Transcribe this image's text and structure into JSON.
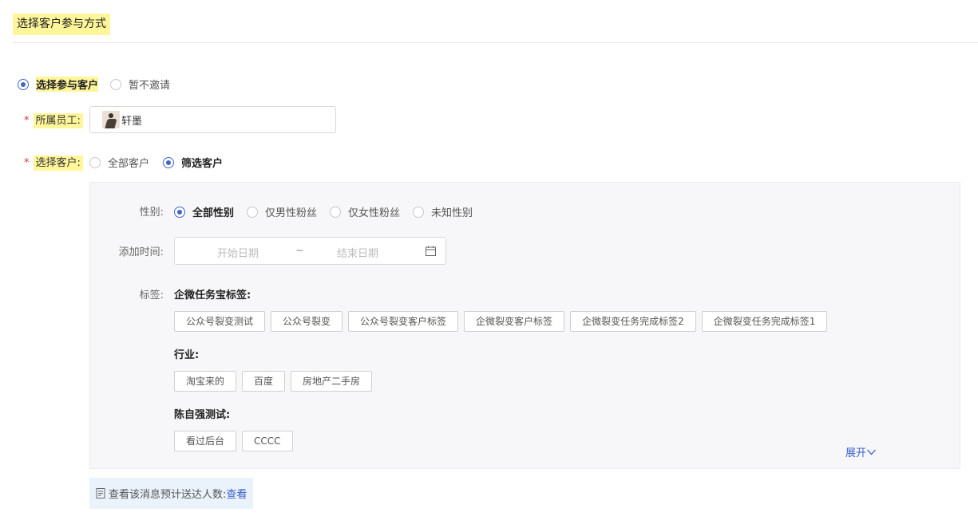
{
  "section": {
    "title": "选择客户参与方式"
  },
  "participation": {
    "options": [
      {
        "label": "选择参与客户",
        "checked": true
      },
      {
        "label": "暂不邀请",
        "checked": false
      }
    ]
  },
  "employee": {
    "label": "所属员工:",
    "required_mark": "*",
    "name": "轩墨"
  },
  "customers": {
    "label": "选择客户:",
    "required_mark": "*",
    "options": [
      {
        "label": "全部客户",
        "checked": false
      },
      {
        "label": "筛选客户",
        "checked": true
      }
    ]
  },
  "filter": {
    "gender": {
      "label": "性别:",
      "options": [
        {
          "label": "全部性别",
          "checked": true
        },
        {
          "label": "仅男性粉丝",
          "checked": false
        },
        {
          "label": "仅女性粉丝",
          "checked": false
        },
        {
          "label": "未知性别",
          "checked": false
        }
      ]
    },
    "add_time": {
      "label": "添加时间:",
      "start_placeholder": "开始日期",
      "separator": "~",
      "end_placeholder": "结束日期",
      "icon": "calendar-icon"
    },
    "tags": {
      "label": "标签:",
      "groups": [
        {
          "title": "企微任务宝标签:",
          "tags": [
            "公众号裂变测试",
            "公众号裂变",
            "公众号裂变客户标签",
            "企微裂变客户标签",
            "企微裂变任务完成标签2",
            "企微裂变任务完成标签1"
          ]
        },
        {
          "title": "行业:",
          "tags": [
            "淘宝来的",
            "百度",
            "房地产二手房"
          ]
        },
        {
          "title": "陈自强测试:",
          "tags": [
            "看过后台",
            "CCCC"
          ]
        }
      ]
    },
    "expand_label": "展开",
    "expand_icon": "chevron-down-icon"
  },
  "estimate": {
    "icon": "document-icon",
    "text": "查看该消息预计送达人数:",
    "link": "查看"
  },
  "colors": {
    "accent": "#4164c8",
    "link": "#3a5fcd",
    "highlight": "#fff69a",
    "required": "#e0352b",
    "panel_bg": "#f7f7f9",
    "estimate_bg": "#eaf2fb"
  }
}
